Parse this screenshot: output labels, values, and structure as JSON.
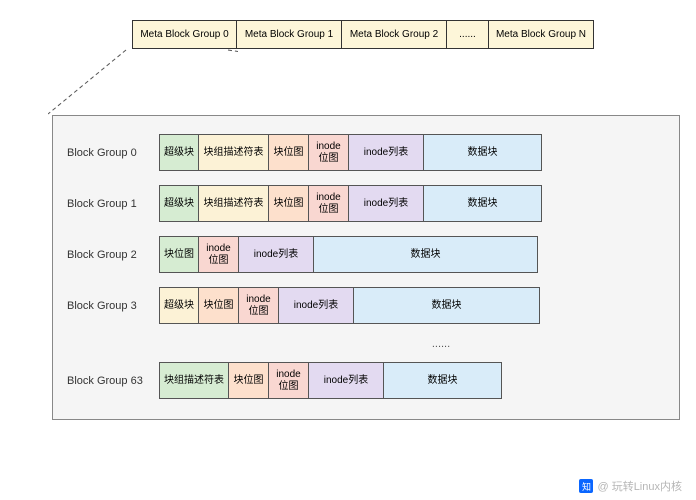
{
  "meta_groups": [
    "Meta Block Group 0",
    "Meta Block Group 1",
    "Meta Block Group 2",
    "......",
    "Meta Block Group N"
  ],
  "seg_labels": {
    "superblock": "超级块",
    "group_desc": "块组描述符表",
    "block_bitmap": "块位图",
    "inode_bitmap": "inode\n位图",
    "inode_list": "inode列表",
    "data_block": "数据块"
  },
  "block_groups": [
    {
      "label": "Block Group 0",
      "segments": [
        "superblock",
        "group_desc",
        "block_bitmap",
        "inode_bitmap",
        "inode_list",
        "data_block"
      ],
      "data_width": "s"
    },
    {
      "label": "Block Group 1",
      "segments": [
        "superblock",
        "group_desc",
        "block_bitmap",
        "inode_bitmap",
        "inode_list",
        "data_block"
      ],
      "data_width": "s"
    },
    {
      "label": "Block Group 2",
      "segments": [
        "block_bitmap",
        "inode_bitmap",
        "inode_list",
        "data_block"
      ],
      "data_width": "l",
      "bitmap_color": "green"
    },
    {
      "label": "Block Group 3",
      "segments": [
        "superblock",
        "block_bitmap",
        "inode_bitmap",
        "inode_list",
        "data_block"
      ],
      "data_width": "m",
      "super_color": "cream"
    },
    {
      "label": "Block Group 63",
      "segments": [
        "group_desc",
        "block_bitmap",
        "inode_bitmap",
        "inode_list",
        "data_block"
      ],
      "data_width": "s",
      "desc_color": "green"
    }
  ],
  "ellipsis": "......",
  "watermark": {
    "logo": "知",
    "text": "@ 玩转Linux内核"
  }
}
